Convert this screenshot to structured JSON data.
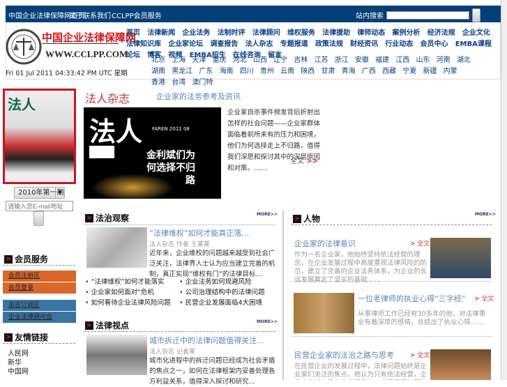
{
  "topbar": {
    "links": [
      "中国企业法律保障网首页",
      "关于",
      "联系我们",
      "CCLPP会员服务"
    ],
    "search_label": "站内搜索",
    "search_value": ""
  },
  "logo": {
    "text": "中国企业法律保障网",
    "url": "WWW.CCLPP.COM"
  },
  "datetime": "Fri 01 Jul 2011 04:33:42 PM UTC 星期",
  "nav_primary": [
    "首页",
    "法律新闻",
    "企业法务",
    "法制时评",
    "法律顾问",
    "维权服务",
    "法律援助",
    "律师动态",
    "案例分析",
    "经济法规",
    "企业文化",
    "法律知识库",
    "企业家论坛",
    "调查报告",
    "法人杂志",
    "专题报道",
    "政策法规",
    "财经资讯",
    "行业动态",
    "会员中心",
    "EMBA课程",
    "论坛",
    "博客",
    "视频",
    "EMBA招生",
    "在线咨询",
    "留言"
  ],
  "nav_secondary": [
    "北京",
    "上海",
    "天津",
    "重庆",
    "河北",
    "山西",
    "辽宁",
    "吉林",
    "江苏",
    "浙江",
    "安徽",
    "福建",
    "江西",
    "山东",
    "河南",
    "湖北",
    "湖南",
    "黑龙江",
    "广东",
    "海南",
    "四川",
    "贵州",
    "云南",
    "陕西",
    "甘肃",
    "青海",
    "广西",
    "西藏",
    "宁夏",
    "新疆",
    "内蒙",
    "香港",
    "台湾",
    "澳门特"
  ],
  "sidebar": {
    "issue_select": "2010年第一期",
    "email_placeholder": "请输入您E-mail地址",
    "sections": [
      {
        "title": "会员服务",
        "items": [
          "会员注册区",
          "会员登录"
        ]
      },
      {
        "items": [
          "杂志订阅区",
          "企业法律顾问会"
        ]
      },
      {
        "title": "友情链接",
        "items": [
          "人民网",
          "新华",
          "中国网"
        ]
      }
    ]
  },
  "feature": {
    "title": "法人杂志",
    "subtitle": "企业家的法务参考及资讯",
    "image_headline": "金利斌们为何选择不归路",
    "image_brand": "法人",
    "image_issue": "FAREN 2011 08",
    "summary": "企业家自杀事件频发背后折射出怎样的社会问题——企业家群体面临着前所未有的压力和困境，他们为何选择走上不归路，值得我们深思和探讨其中的深层原因和对策。……",
    "more": "全文"
  },
  "section1": {
    "title": "法治观察",
    "more": "MORE>>",
    "headline": "“法律维权”如何才能真正落…",
    "meta": "法人杂志 作者 王某某",
    "desc": "近年来，企业维权的问题越来越受到社会广泛关注，法律界人士认为应当建立完善的机制，真正实现“维权有门”的法律目标…",
    "bullets": [
      "“法律维权”如何才能落实",
      "企业家如何面对“危机",
      "如何看待企业法律风险问题",
      "企业法务如何规避风险",
      "公司治理结构中的法律问题",
      "民营企业发展面临4大困境"
    ]
  },
  "section2": {
    "title": "法律视点",
    "more": "MORE>>",
    "headline": "城市拆迁中的法律问题值得关注…",
    "meta": "法人杂志 记者某",
    "desc": "城市化进程中的拆迁问题已经成为社会矛盾的焦点之一，如何在法律框架内妥善处理各方利益关系，值得深入探讨和研究…"
  },
  "section3": {
    "title": "人物",
    "more": "MORE>>",
    "items": [
      {
        "title": "企业家的法律意识",
        "more": "全文",
        "desc": "作为一名企业家，他始终坚持依法经营的理念，在企业发展过程中高度重视法律风险的防范，建立了完善的企业法务体系，为企业的长远发展奠定了坚实的基础……"
      },
      {
        "title": "一位老律师的执业心得“三字经”",
        "more": "全文",
        "desc": "从事律师工作已经有30多年的他，对法律事业有着深厚的感情，总结出了执业心得……"
      },
      {
        "title": "民营企业家的法治之路与思考",
        "more": "全文",
        "desc": "在民营企业的发展过程中，法律问题始终是企业家们关注的焦点，他认为只有依法经营，企业才能长久稳定地发展下去，实现真正的可持续发展目标和理想"
      }
    ]
  }
}
